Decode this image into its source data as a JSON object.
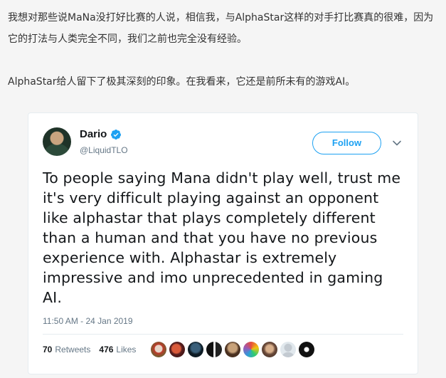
{
  "article": {
    "paragraph1": "我想对那些说MaNa没打好比赛的人说，相信我，与AlphaStar这样的对手打比赛真的很难，因为它的打法与人类完全不同，我们之前也完全没有经验。",
    "paragraph2": "AlphaStar给人留下了极其深刻的印象。在我看来，它还是前所未有的游戏AI。"
  },
  "tweet": {
    "display_name": "Dario",
    "handle": "@LiquidTLO",
    "follow_label": "Follow",
    "text": "To people saying Mana didn't play well, trust me it's very difficult playing against an opponent like alphastar that plays completely different than a human and that you have no previous experience with. Alphastar is extremely impressive and imo unprecedented in gaming AI.",
    "timestamp": "11:50 AM - 24 Jan 2019",
    "retweets_count": "70",
    "retweets_label": "Retweets",
    "likes_count": "476",
    "likes_label": "Likes",
    "liker_avatars": [
      "avatar-1",
      "avatar-2",
      "avatar-3",
      "avatar-4",
      "avatar-5",
      "avatar-6",
      "avatar-7",
      "avatar-8",
      "avatar-9"
    ]
  },
  "icons": {
    "verified": "verified-badge-icon",
    "menu": "chevron-down-icon"
  },
  "colors": {
    "twitter_blue": "#1da1f2",
    "text_primary": "#14171a",
    "text_secondary": "#657786",
    "page_background": "#f5f5f5"
  }
}
